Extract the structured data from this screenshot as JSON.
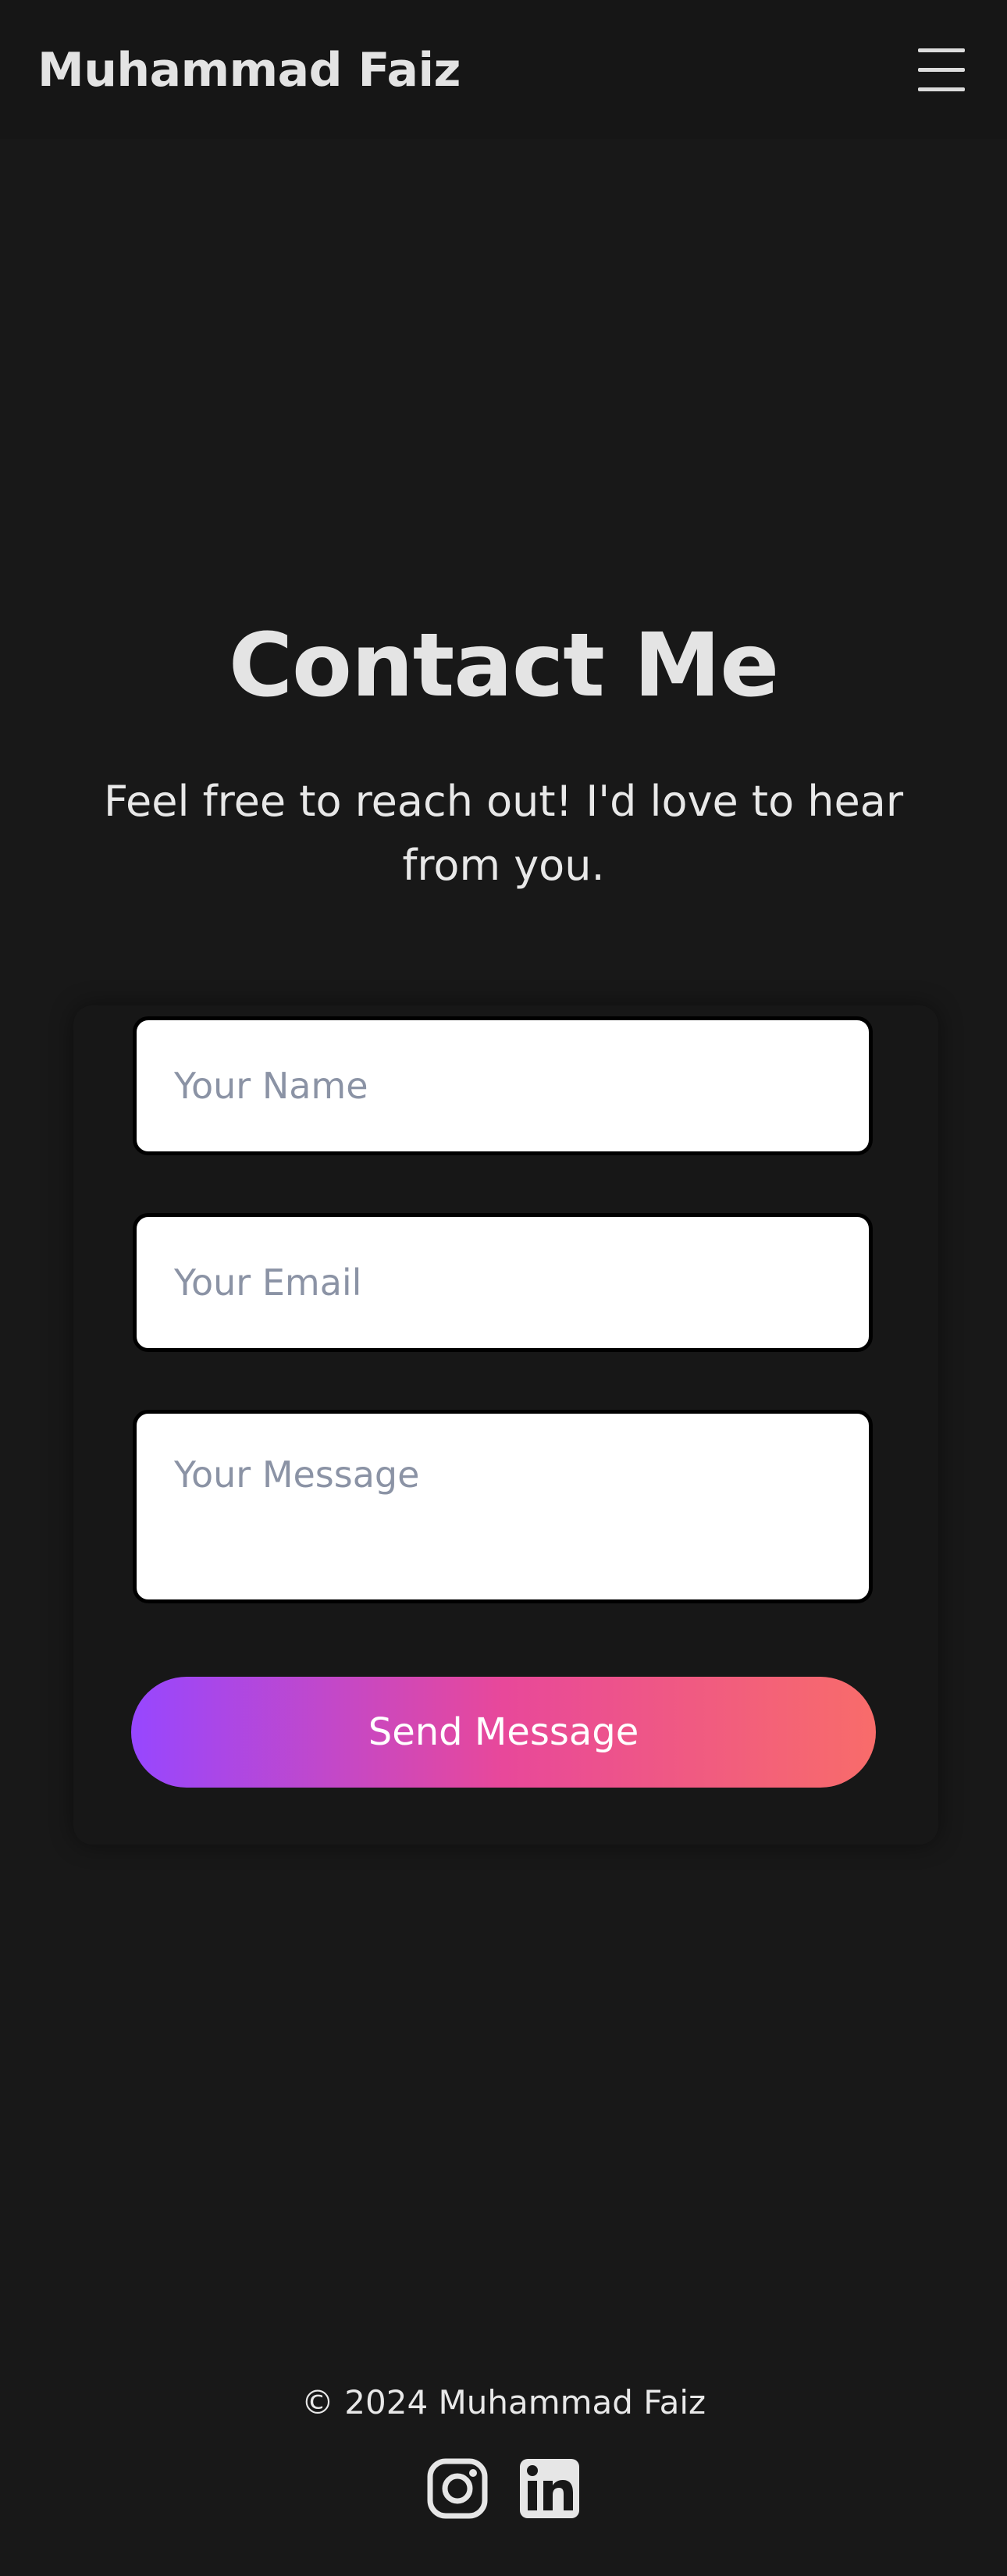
{
  "header": {
    "brand": "Muhammad Faiz",
    "menu_icon": "hamburger-menu-icon"
  },
  "contact": {
    "title": "Contact Me",
    "subtitle": "Feel free to reach out! I'd love to hear from you.",
    "form": {
      "name_placeholder": "Your Name",
      "name_value": "",
      "email_placeholder": "Your Email",
      "email_value": "",
      "message_placeholder": "Your Message",
      "message_value": "",
      "submit_label": "Send Message"
    }
  },
  "footer": {
    "copyright": "© 2024 Muhammad Faiz",
    "social": [
      {
        "icon": "instagram-icon"
      },
      {
        "icon": "linkedin-icon"
      }
    ]
  },
  "colors": {
    "background": "#181818",
    "text": "#e6e6e6",
    "button_gradient_start": "#9747ff",
    "button_gradient_mid": "#e8489a",
    "button_gradient_end": "#f86c6a",
    "input_background": "#ffffff",
    "placeholder": "#8b93a5"
  }
}
